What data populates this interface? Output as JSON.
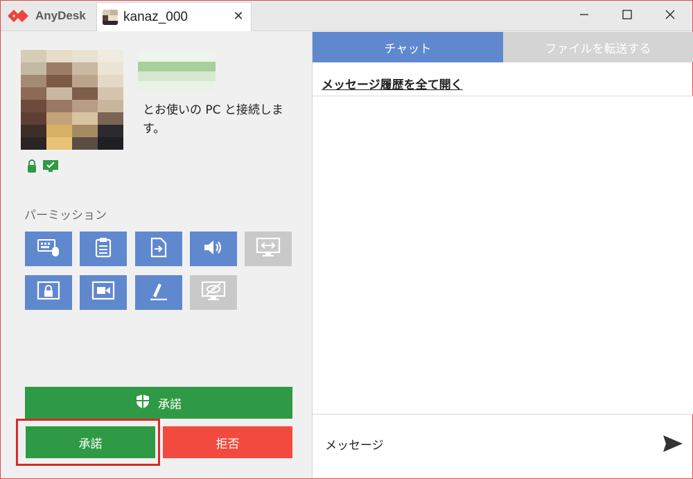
{
  "app": {
    "name": "AnyDesk"
  },
  "tab": {
    "title": "kanaz_000",
    "close_glyph": "✕"
  },
  "window_controls": [
    "minimize-icon",
    "maximize-icon",
    "close-icon"
  ],
  "session": {
    "message": "とお使いの PC と接続します。"
  },
  "permissions": {
    "title": "パーミッション",
    "items": [
      {
        "icon": "keyboard-mouse-icon",
        "enabled": true
      },
      {
        "icon": "clipboard-icon",
        "enabled": true
      },
      {
        "icon": "file-transfer-icon",
        "enabled": true
      },
      {
        "icon": "sound-icon",
        "enabled": true
      },
      {
        "icon": "switch-sides-icon",
        "enabled": false
      },
      {
        "icon": "lock-screen-icon",
        "enabled": true
      },
      {
        "icon": "record-session-icon",
        "enabled": true
      },
      {
        "icon": "draw-icon",
        "enabled": true
      },
      {
        "icon": "privacy-mode-icon",
        "enabled": false
      }
    ]
  },
  "actions": {
    "accept_elevated": "承諾",
    "accept": "承諾",
    "reject": "拒否"
  },
  "chat": {
    "tabs": [
      "チャット",
      "ファイルを転送する"
    ],
    "history_link": "メッセージ履歴を全て開く",
    "input_placeholder": "メッセージ"
  },
  "colors": {
    "accent_blue": "#5f88cf",
    "accept_green": "#2f9a45",
    "reject_red": "#f24a3f",
    "highlight_red": "#d42c2c",
    "disabled_gray": "#c9c9c9"
  }
}
